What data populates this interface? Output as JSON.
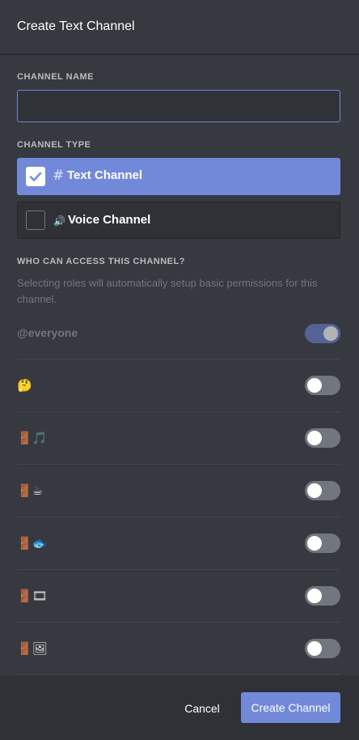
{
  "modal": {
    "title": "Create Text Channel"
  },
  "channel_name": {
    "label": "CHANNEL NAME",
    "value": "",
    "placeholder": ""
  },
  "channel_type": {
    "label": "CHANNEL TYPE",
    "options": [
      {
        "label": "Text Channel",
        "icon": "hash-icon",
        "glyph": "#",
        "selected": true
      },
      {
        "label": "Voice Channel",
        "icon": "speaker-icon",
        "glyph": "🔊",
        "selected": false
      }
    ]
  },
  "access": {
    "label": "WHO CAN ACCESS THIS CHANNEL?",
    "description": "Selecting roles will automatically setup basic permissions for this channel.",
    "roles": [
      {
        "name": "@everyone",
        "enabled": true
      },
      {
        "name": "🤔",
        "enabled": false
      },
      {
        "name": "🚪🎵",
        "enabled": false
      },
      {
        "name": "🚪☕",
        "enabled": false
      },
      {
        "name": "🚪🐟",
        "enabled": false
      },
      {
        "name": "🚪🎞",
        "enabled": false
      },
      {
        "name": "🚪🖼",
        "enabled": false
      }
    ]
  },
  "footer": {
    "cancel_label": "Cancel",
    "create_label": "Create Channel"
  },
  "colors": {
    "accent": "#7289da",
    "background": "#36393f",
    "footer": "#2f3136"
  }
}
